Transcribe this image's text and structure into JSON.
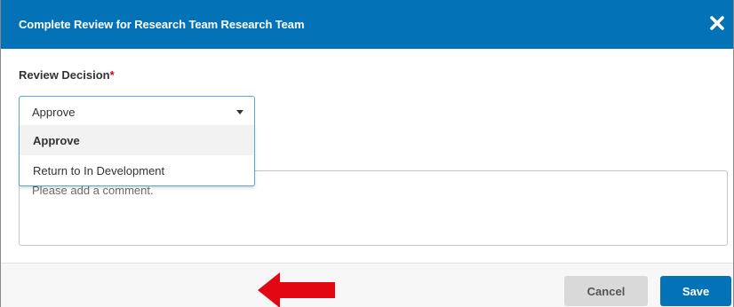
{
  "dialog": {
    "title": "Complete Review for Research Team Research Team",
    "close_icon": "close-icon"
  },
  "review_decision": {
    "label": "Review Decision",
    "required_marker": "*",
    "selected_value": "Approve",
    "options": [
      {
        "label": "Approve",
        "selected": true
      },
      {
        "label": "Return to In Development",
        "selected": false
      }
    ]
  },
  "comment": {
    "placeholder": "Please add a comment.",
    "value": ""
  },
  "footer": {
    "cancel_label": "Cancel",
    "save_label": "Save"
  },
  "annotation": {
    "arrow_color": "#e30613"
  },
  "colors": {
    "header_bg": "#0472b6",
    "primary_button": "#0472b6",
    "secondary_button": "#d9d9d9",
    "required": "#d0021b",
    "focus_border": "#5aa7d9"
  }
}
